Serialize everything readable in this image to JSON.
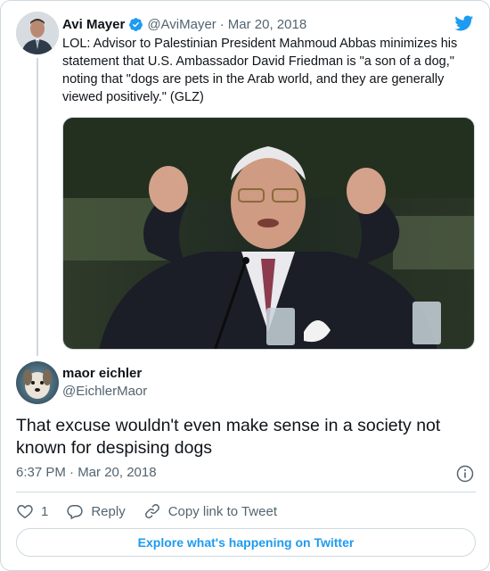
{
  "colors": {
    "brand": "#1d9bf0",
    "text_primary": "#0f1419",
    "text_secondary": "#536471",
    "border": "#cfd9de"
  },
  "quoted_tweet": {
    "author_name": "Avi Mayer",
    "verified": true,
    "handle": "@AviMayer",
    "separator": "·",
    "date": "Mar 20, 2018",
    "text": "LOL: Advisor to Palestinian President Mahmoud Abbas minimizes his statement that U.S. Ambassador David Friedman is \"a son of a dog,\" noting that \"dogs are pets in the Arab world, and they are generally viewed positively.\" (GLZ)",
    "avatar_icon": "avatar-photo",
    "media_icon": "news-photo"
  },
  "reply_tweet": {
    "author_name": "maor eichler",
    "handle": "@EichlerMaor",
    "text": "That excuse wouldn't even make sense in a society not known for despising dogs",
    "timestamp": "6:37 PM · Mar 20, 2018",
    "avatar_icon": "avatar-dog"
  },
  "actions": {
    "like_count": "1",
    "reply_label": "Reply",
    "copy_link_label": "Copy link to Tweet"
  },
  "explore_label": "Explore what's happening on Twitter",
  "icons": [
    "twitter-bird-icon",
    "verified-icon",
    "info-icon",
    "heart-icon",
    "reply-icon",
    "link-icon"
  ]
}
